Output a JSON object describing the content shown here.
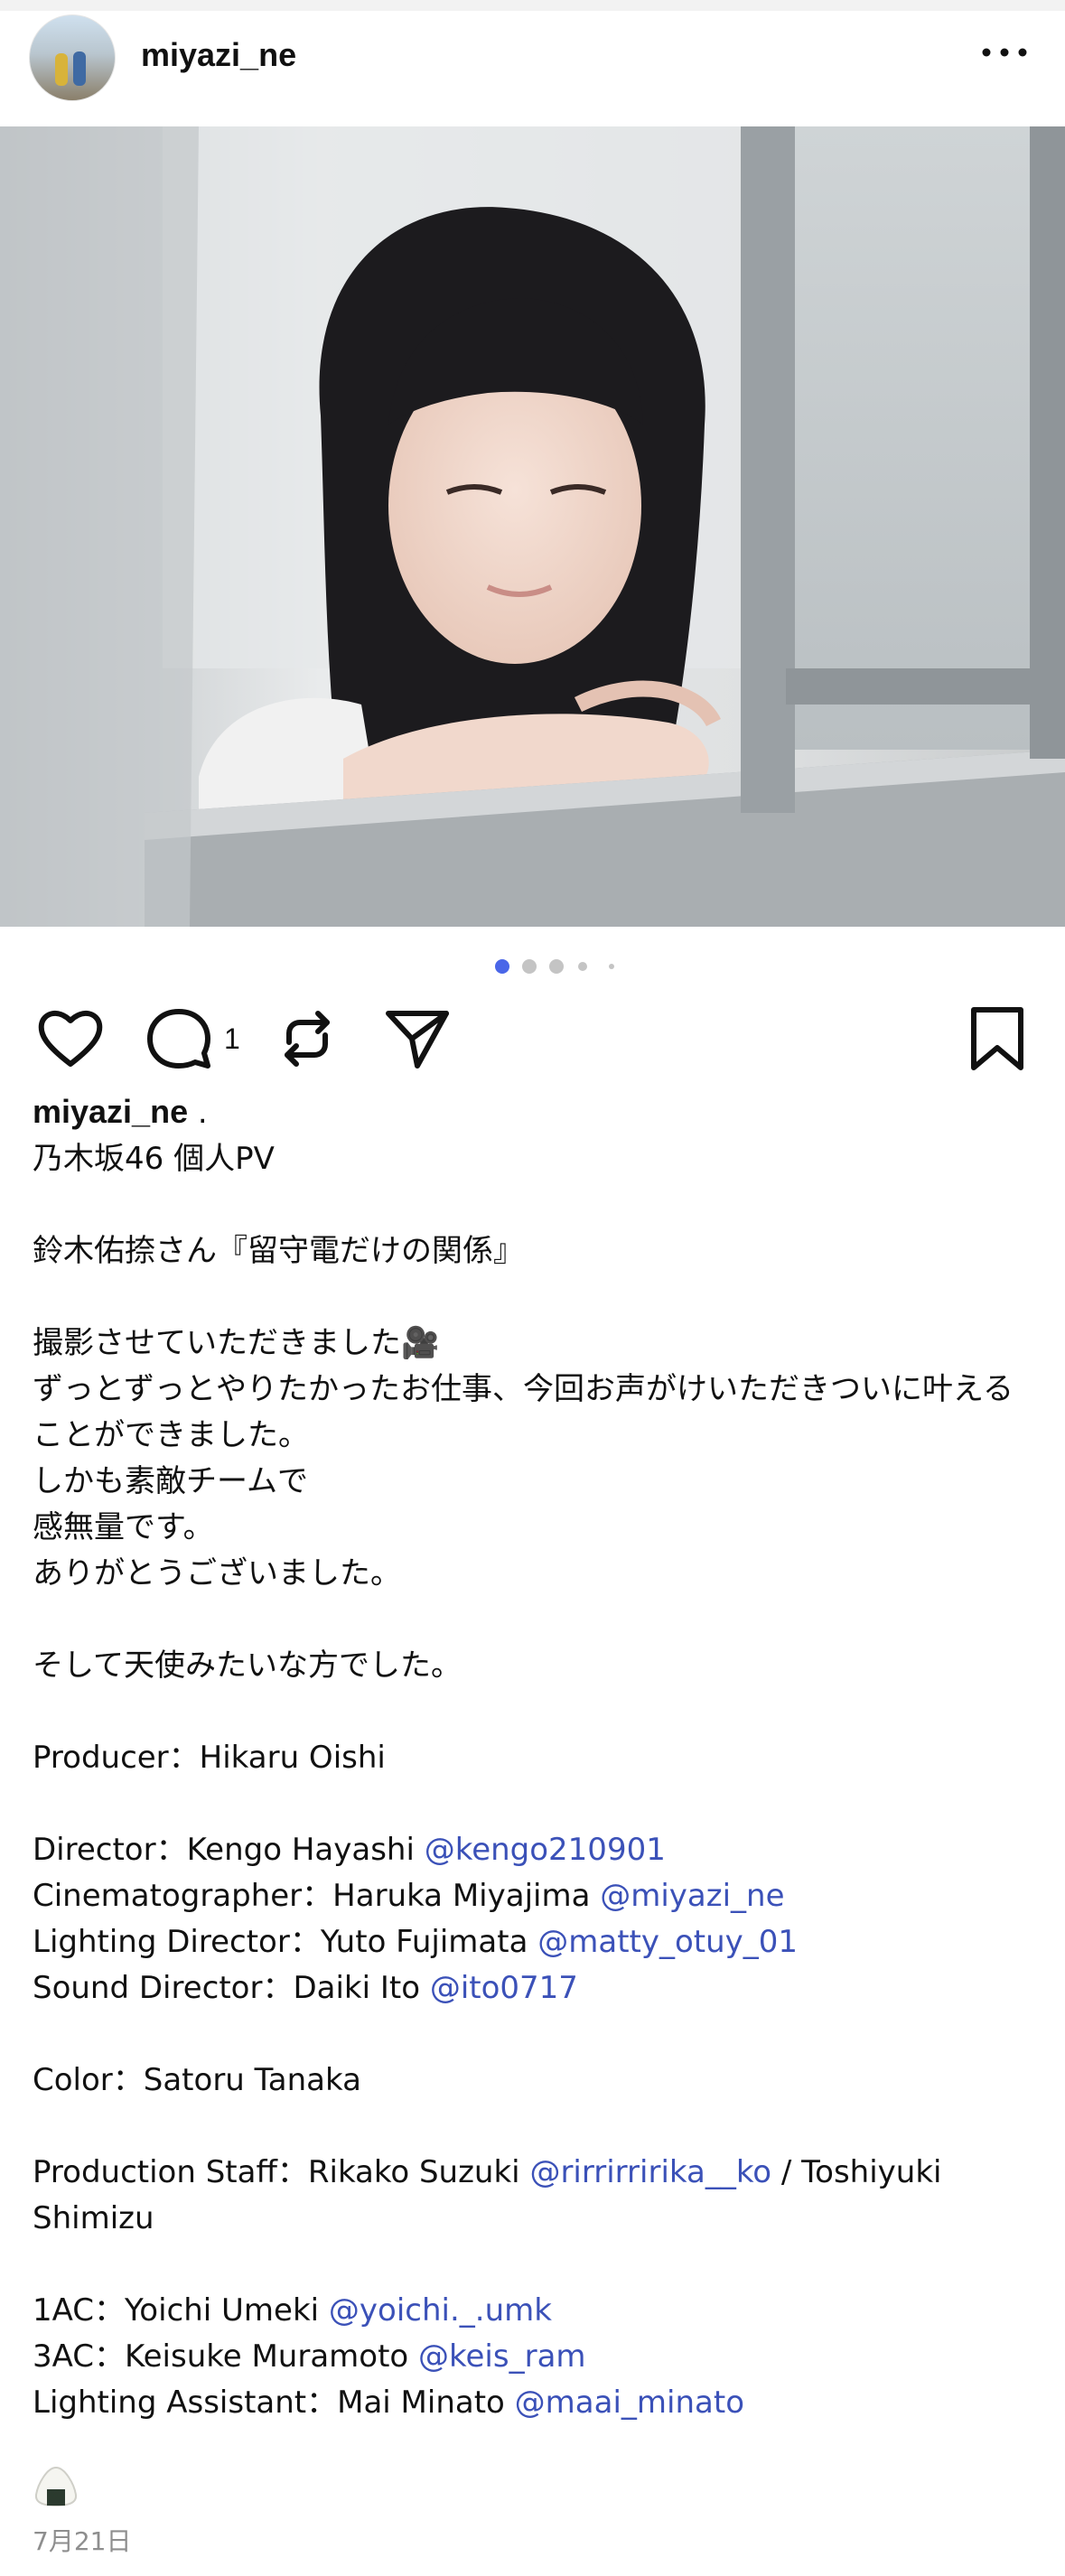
{
  "post": {
    "username": "miyazi_ne",
    "comment_count": "1",
    "date": "7月21日",
    "carousel": {
      "total": 5,
      "active_index": 0
    },
    "colors": {
      "accent": "#3b51b8",
      "active_dot": "#4a66e8",
      "inactive_dot": "#c4c4c4"
    },
    "icons": [
      "more-options-icon",
      "heart-icon",
      "comment-icon",
      "repost-icon",
      "share-icon",
      "bookmark-icon"
    ]
  },
  "caption": {
    "user": "miyazi_ne",
    "user_suffix": " .",
    "lines": [
      [
        {
          "t": "乃木坂46 個人PV"
        }
      ],
      [],
      [
        {
          "t": "鈴木佑捺さん『留守電だけの関係』"
        }
      ],
      [],
      [
        {
          "t": "撮影させていただきました🎥"
        }
      ],
      [
        {
          "t": "ずっとずっとやりたかったお仕事、今回お声がけいただきついに叶えることができました。"
        }
      ],
      [
        {
          "t": "しかも素敵チームで"
        }
      ],
      [
        {
          "t": "感無量です。"
        }
      ],
      [
        {
          "t": "ありがとうございました。"
        }
      ],
      [],
      [
        {
          "t": "そして天使みたいな方でした。"
        }
      ],
      [],
      [
        {
          "t": "Producer：Hikaru Oishi"
        }
      ],
      [],
      [
        {
          "t": "Director：Kengo Hayashi "
        },
        {
          "t": "@kengo210901",
          "m": true
        }
      ],
      [
        {
          "t": "Cinematographer：Haruka Miyajima "
        },
        {
          "t": "@miyazi_ne",
          "m": true
        }
      ],
      [
        {
          "t": "Lighting Director：Yuto Fujimata "
        },
        {
          "t": "@matty_otuy_01",
          "m": true
        }
      ],
      [
        {
          "t": "Sound Director：Daiki Ito "
        },
        {
          "t": "@ito0717",
          "m": true
        }
      ],
      [],
      [
        {
          "t": "Color：Satoru Tanaka"
        }
      ],
      [],
      [
        {
          "t": "Production Staff：Rikako Suzuki "
        },
        {
          "t": "@rirrirririka__ko",
          "m": true
        },
        {
          "t": " / Toshiyuki Shimizu"
        }
      ],
      [],
      [
        {
          "t": "1AC：Yoichi Umeki "
        },
        {
          "t": "@yoichi._.umk",
          "m": true
        }
      ],
      [
        {
          "t": "3AC：Keisuke Muramoto "
        },
        {
          "t": "@keis_ram",
          "m": true
        }
      ],
      [
        {
          "t": "Lighting Assistant：Mai Minato "
        },
        {
          "t": "@maai_minato",
          "m": true
        }
      ]
    ],
    "emoji_line": "🍙"
  }
}
